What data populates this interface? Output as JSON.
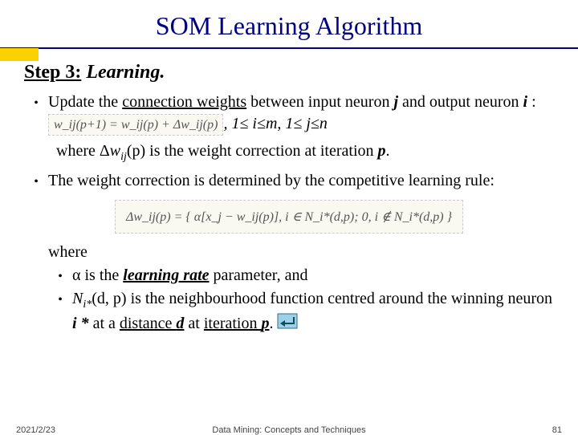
{
  "title": "SOM Learning Algorithm",
  "step": {
    "label": "Step 3:",
    "name": "Learning."
  },
  "b1": {
    "pre": "Update the ",
    "link": "connection weights",
    "mid": " between input neuron ",
    "j": "j",
    "and": " and output neuron ",
    "i": "i",
    "colon": " : ",
    "eq_inline": "w_ij(p+1) = w_ij(p) + Δw_ij(p)",
    "range": ", 1≤ i≤m, 1≤ j≤n"
  },
  "where1": {
    "pre": "where Δ",
    "w": "w",
    "sub": "ij",
    "p": "(p)",
    "post": " is the weight correction at iteration ",
    "pvar": "p",
    "dot": "."
  },
  "b2": "The weight correction is determined by the competitive learning rule:",
  "eq_block": "Δw_ij(p) = { α[x_j − w_ij(p)],  i ∈ N_i*(d,p);   0,  i ∉ N_i*(d,p) }",
  "where2": "where",
  "sub1": {
    "alpha": "α",
    "rest1": " is the ",
    "lr": "learning rate",
    "rest2": " parameter, and"
  },
  "sub2": {
    "N": "N",
    "sub": "i*",
    "args": "(d, p)",
    "rest1": " is the neighbourhood function centred around the winning neuron ",
    "istar": "i *",
    "at1": " at a ",
    "dist": "distance ",
    "d": "d",
    "at2": " at ",
    "iter": "iteration ",
    "p": "p",
    "dot": "."
  },
  "footer": {
    "date": "2021/2/23",
    "center": "Data Mining: Concepts and Techniques",
    "page": "81"
  }
}
